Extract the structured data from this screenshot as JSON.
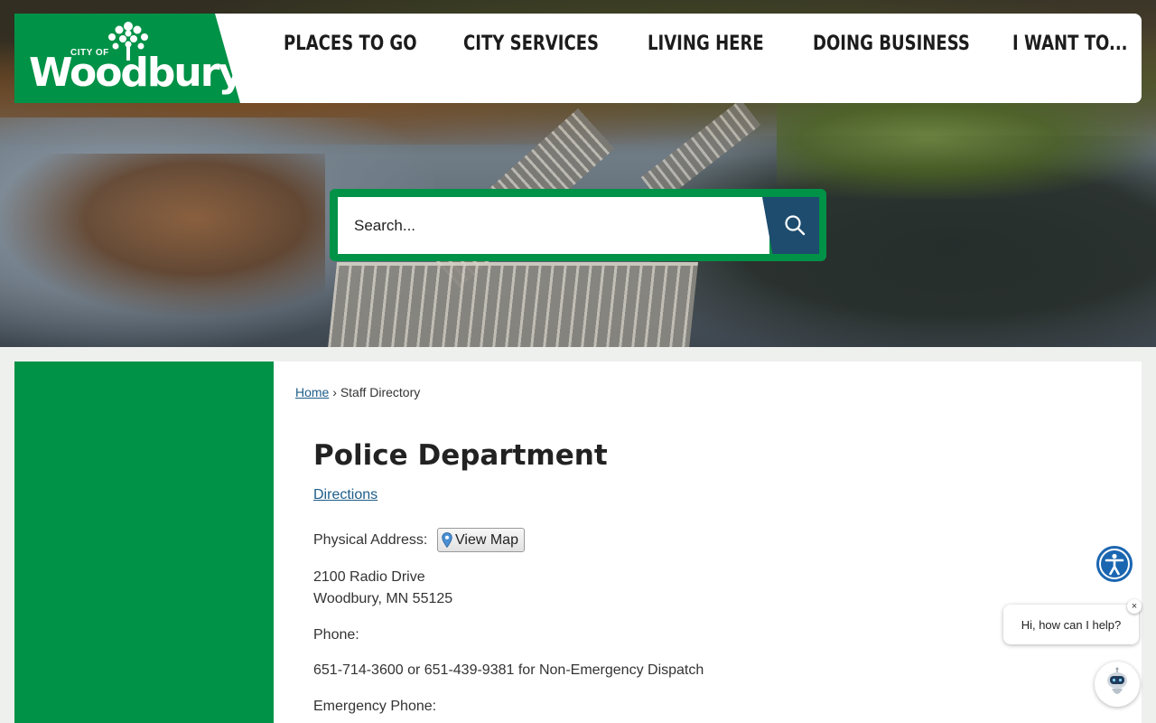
{
  "brand": {
    "logo_small_text": "CITY OF",
    "logo_word": "Woodbury",
    "green": "#009247",
    "navy": "#1d4c6e",
    "link": "#1d5d8a"
  },
  "nav": {
    "items": [
      {
        "label": "PLACES TO GO"
      },
      {
        "label": "CITY SERVICES"
      },
      {
        "label": "LIVING HERE"
      },
      {
        "label": "DOING BUSINESS"
      },
      {
        "label": "I WANT TO..."
      }
    ]
  },
  "search": {
    "placeholder": "Search..."
  },
  "breadcrumb": {
    "home": "Home",
    "separator": "›",
    "current": "Staff Directory"
  },
  "department": {
    "title": "Police Department",
    "directions": "Directions",
    "address_label": "Physical Address:",
    "view_map": "View Map",
    "address_line1": "2100 Radio Drive",
    "address_line2": "Woodbury, MN 55125",
    "phone_label": "Phone:",
    "phone_value": "651-714-3600 or 651-439-9381 for Non-Emergency Dispatch",
    "emergency_label": "Emergency Phone:"
  },
  "chat": {
    "greeting": "Hi, how can I help?",
    "close": "×"
  },
  "icons": {
    "search": "search-icon",
    "map_pin": "map-pin-icon",
    "accessibility": "accessibility-icon",
    "chatbot": "chatbot-icon"
  }
}
